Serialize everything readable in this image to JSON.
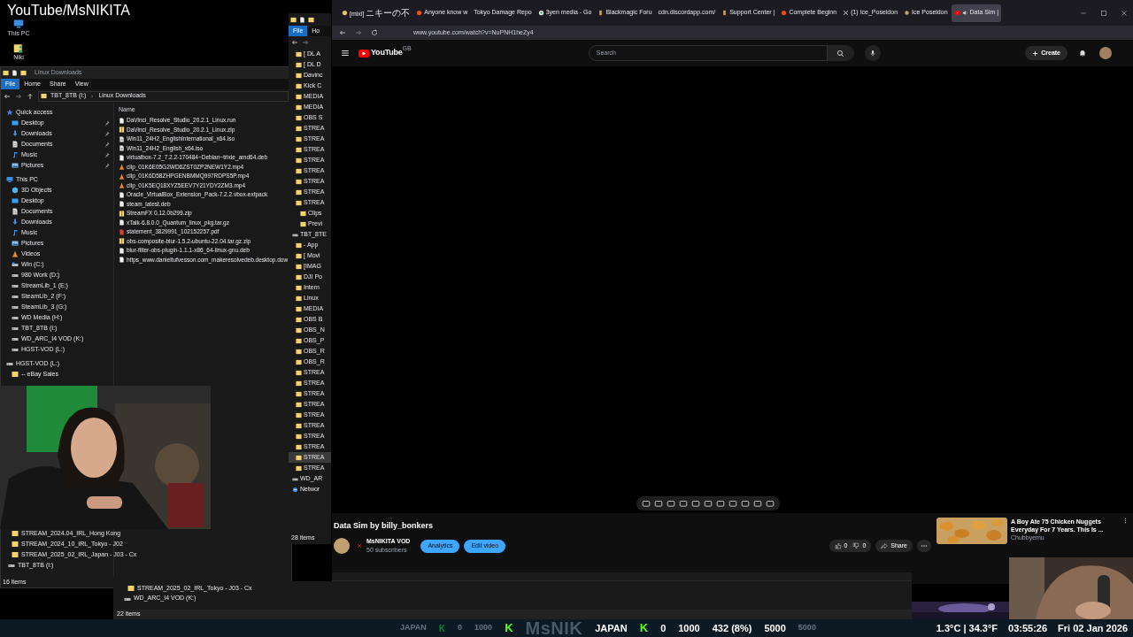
{
  "overlay_title": "YouTube/MsNIKITA",
  "desktop_icons": [
    {
      "label": "This PC",
      "kind": "pc"
    },
    {
      "label": "Niki",
      "kind": "user"
    }
  ],
  "explorer_main": {
    "title": "Linux Downloads",
    "ribbon_tabs": [
      {
        "label": "File",
        "selected": true
      },
      {
        "label": "Home",
        "selected": false
      },
      {
        "label": "Share",
        "selected": false
      },
      {
        "label": "View",
        "selected": false
      }
    ],
    "breadcrumb": [
      "TBT_8TB (I:)",
      "Linux Downloads"
    ],
    "nav_tree": [
      {
        "label": "Quick access",
        "kind": "star",
        "children": [
          {
            "label": "Desktop",
            "kind": "desktop",
            "pinned": true
          },
          {
            "label": "Downloads",
            "kind": "download",
            "pinned": true
          },
          {
            "label": "Documents",
            "kind": "doc",
            "pinned": true
          },
          {
            "label": "Music",
            "kind": "music",
            "pinned": true
          },
          {
            "label": "Pictures",
            "kind": "picture",
            "pinned": true
          }
        ]
      },
      {
        "label": "This PC",
        "kind": "pc",
        "children": [
          {
            "label": "3D Objects",
            "kind": "cube"
          },
          {
            "label": "Desktop",
            "kind": "desktop"
          },
          {
            "label": "Documents",
            "kind": "doc"
          },
          {
            "label": "Downloads",
            "kind": "download"
          },
          {
            "label": "Music",
            "kind": "music"
          },
          {
            "label": "Pictures",
            "kind": "picture"
          },
          {
            "label": "Videos",
            "kind": "video"
          },
          {
            "label": "Win (C:)",
            "kind": "windrive"
          },
          {
            "label": "980 Work (D:)",
            "kind": "drive"
          },
          {
            "label": "StreamLib_1 (E:)",
            "kind": "drive"
          },
          {
            "label": "SteamLib_2 (F:)",
            "kind": "drive"
          },
          {
            "label": "SteamLib_3 (G:)",
            "kind": "drive"
          },
          {
            "label": "WD Media (H:)",
            "kind": "drive"
          },
          {
            "label": "TBT_8TB (I:)",
            "kind": "drive"
          },
          {
            "label": "WD_ARC_I4 VOD (K:)",
            "kind": "drive"
          },
          {
            "label": "HGST-VOD (L:)",
            "kind": "drive"
          }
        ]
      },
      {
        "label": "HGST-VOD (L:)",
        "kind": "drive",
        "children": [
          {
            "label": "-- eBay Sales",
            "kind": "folder"
          }
        ]
      }
    ],
    "nav_tree_lower": [
      {
        "label": "STREAM_2024.04_IRL_Hong Kong",
        "kind": "folder"
      },
      {
        "label": "STREAM_2024_10_IRL_Tokyo - J02",
        "kind": "folder"
      },
      {
        "label": "STREAM_2025_02_IRL_Japan - J03 - Cx",
        "kind": "folder"
      },
      {
        "label": "TBT_8TB (I:)",
        "kind": "drive"
      }
    ],
    "column": "Name",
    "files": [
      {
        "name": "DaVinci_Resolve_Studio_20.2.1_Linux.run",
        "kind": "file"
      },
      {
        "name": "DaVinci_Resolve_Studio_20.2.1_Linux.zip",
        "kind": "zip"
      },
      {
        "name": "Win11_24H2_EnglishInternational_x64.iso",
        "kind": "disc"
      },
      {
        "name": "Win11_24H2_English_x64.iso",
        "kind": "disc"
      },
      {
        "name": "virtualbox-7.2_7.2.2-170484~Debian~trixie_amd64.deb",
        "kind": "file"
      },
      {
        "name": "clip_01K6E05G2WD6ZST0ZP2NEW1Y2.mp4",
        "kind": "video"
      },
      {
        "name": "clip_01K6D58ZHPGENBMMQ997RDPS5P.mp4",
        "kind": "video"
      },
      {
        "name": "clip_01K5EQ18XYZ5EEV7Y21YDY2ZM3.mp4",
        "kind": "video"
      },
      {
        "name": "Oracle_VirtualBox_Extension_Pack-7.2.2.vbox-extpack",
        "kind": "file"
      },
      {
        "name": "steam_latest.deb",
        "kind": "file"
      },
      {
        "name": "StreamFX 0.12.0b299.zip",
        "kind": "zip"
      },
      {
        "name": "xTalk-6.8.0.0_Quantum_linux_pkg.tar.gz",
        "kind": "file"
      },
      {
        "name": "statement_3829991_102152257.pdf",
        "kind": "pdf"
      },
      {
        "name": "obs-composite-blur-1.5.2-ubuntu-22.04.tar.gz.zip",
        "kind": "zip"
      },
      {
        "name": "blur-filter-obs-plugin-1.1.1-x86_64-linux-gnu.deb",
        "kind": "file"
      },
      {
        "name": "https_www.danieltufvesson.com_makeresolvedeb.desktop.dow",
        "kind": "file"
      }
    ],
    "status": "16 items"
  },
  "explorer_middle": {
    "ribbon_tabs": [
      {
        "label": "File",
        "selected": true
      },
      {
        "label": "Ho",
        "selected": false
      }
    ],
    "tree": [
      {
        "label": "[ DL A",
        "kind": "folder",
        "selected": false
      },
      {
        "label": "[ DL D",
        "kind": "folder",
        "selected": false
      },
      {
        "label": "Davinc",
        "kind": "folder",
        "selected": false
      },
      {
        "label": "Kick C",
        "kind": "folder",
        "selected": false
      },
      {
        "label": "MEDIA",
        "kind": "folder",
        "selected": false
      },
      {
        "label": "MEDIA",
        "kind": "folder",
        "selected": false
      },
      {
        "label": "OBS S",
        "kind": "folder",
        "selected": false
      },
      {
        "label": "STREA",
        "kind": "folder",
        "selected": false
      },
      {
        "label": "STREA",
        "kind": "folder",
        "selected": false
      },
      {
        "label": "STREA",
        "kind": "folder",
        "selected": false
      },
      {
        "label": "STREA",
        "kind": "folder",
        "selected": false
      },
      {
        "label": "STREA",
        "kind": "folder",
        "selected": false
      },
      {
        "label": "STREA",
        "kind": "folder",
        "selected": false
      },
      {
        "label": "STREA",
        "kind": "folder",
        "selected": false
      },
      {
        "label": "STREA",
        "kind": "folder",
        "selected": false,
        "children": [
          {
            "label": "Clips",
            "kind": "folder",
            "selected": false
          },
          {
            "label": "Previ",
            "kind": "folder",
            "selected": false
          }
        ]
      },
      {
        "label": "TBT_8TE",
        "kind": "drive",
        "selected": false,
        "children": [
          {
            "label": "- App",
            "kind": "folder",
            "selected": false
          },
          {
            "label": "[ Movi",
            "kind": "folder",
            "selected": false
          },
          {
            "label": "[IMAG",
            "kind": "folder",
            "selected": false
          },
          {
            "label": "DJI Po",
            "kind": "folder",
            "selected": false
          },
          {
            "label": "Intern",
            "kind": "folder",
            "selected": false
          },
          {
            "label": "Linux",
            "kind": "folder",
            "selected": false
          },
          {
            "label": "MEDIA",
            "kind": "folder",
            "selected": false
          },
          {
            "label": "OBS B",
            "kind": "folder",
            "selected": false
          },
          {
            "label": "OBS_N",
            "kind": "folder",
            "selected": false
          },
          {
            "label": "OBS_P",
            "kind": "folder",
            "selected": false
          },
          {
            "label": "OBS_R",
            "kind": "folder",
            "selected": false
          },
          {
            "label": "OBS_R",
            "kind": "folder",
            "selected": false
          },
          {
            "label": "STREA",
            "kind": "folder",
            "selected": false
          },
          {
            "label": "STREA",
            "kind": "folder",
            "selected": false
          },
          {
            "label": "STREA",
            "kind": "folder",
            "selected": false
          },
          {
            "label": "STREA",
            "kind": "folder",
            "selected": false
          },
          {
            "label": "STREA",
            "kind": "folder",
            "selected": false
          },
          {
            "label": "STREA",
            "kind": "folder",
            "selected": false
          },
          {
            "label": "STREA",
            "kind": "folder",
            "selected": false
          },
          {
            "label": "STREA",
            "kind": "folder",
            "selected": false
          },
          {
            "label": "STREA",
            "kind": "folder",
            "selected": true
          },
          {
            "label": "STREA",
            "kind": "folder",
            "selected": false
          }
        ]
      },
      {
        "label": "WD_AR",
        "kind": "drive",
        "selected": false
      },
      {
        "label": "Networ",
        "kind": "network",
        "selected": false
      }
    ],
    "status": "28 items"
  },
  "explorer_bottom": {
    "rows": [
      {
        "label": "STREAM_2025_02_IRL_Tokyo - J03 - Cx",
        "kind": "folder"
      },
      {
        "label": "WD_ARC_I4 VOD (K:)",
        "kind": "drive"
      }
    ],
    "status": "22 items"
  },
  "browser": {
    "tabs": [
      {
        "label": "[mixi] ニキーの不",
        "selected": false,
        "playing": false
      },
      {
        "label": "Anyone know w",
        "selected": false,
        "playing": false
      },
      {
        "label": "Tokyo Damage Repo",
        "selected": false,
        "playing": false
      },
      {
        "label": "3yen media - Go",
        "selected": false,
        "playing": false
      },
      {
        "label": "Blackmagic Foru",
        "selected": false,
        "playing": false
      },
      {
        "label": "cdn.discordapp.com/",
        "selected": false,
        "playing": false
      },
      {
        "label": "Support Center |",
        "selected": false,
        "playing": false
      },
      {
        "label": "Complete Beginn",
        "selected": false,
        "playing": false
      },
      {
        "label": "(1) Ice_Poseidon",
        "selected": false,
        "playing": false
      },
      {
        "label": "Ice Poseidon",
        "selected": false,
        "playing": false
      },
      {
        "label": "Data Sim |",
        "selected": true,
        "playing": true
      }
    ],
    "url": "www.youtube.com/watch?v=NuPNH1heZy4"
  },
  "youtube": {
    "logo": "YouTube",
    "region": "GB",
    "search_placeholder": "Search",
    "create": "Create",
    "video_title": "Data Sim by billy_bonkers",
    "channel": "MsNIKITA VOD",
    "subscribers": "50 subscribers",
    "buttons": [
      "Analytics",
      "Edit video"
    ],
    "likes": "0",
    "dislikes": "0",
    "share": "Share",
    "recommendation": {
      "title": "A Boy Ate 75 Chicken Nuggets Everyday For 7 Years. This Is ...",
      "channel": "Chubbyemu"
    }
  },
  "ticker_left": [
    {
      "text": "JAPAN",
      "kind": "dim"
    },
    {
      "text": "K",
      "kind": "kick-dim"
    },
    {
      "text": "0",
      "kind": "dim"
    },
    {
      "text": "1000",
      "kind": "dim"
    },
    {
      "text": "K",
      "kind": "kick"
    },
    {
      "text": "MsNIK",
      "kind": "ghost"
    },
    {
      "text": "JAPAN",
      "kind": "bright"
    },
    {
      "text": "K",
      "kind": "kick"
    },
    {
      "text": "0",
      "kind": "bright"
    },
    {
      "text": "1000",
      "kind": "bright"
    },
    {
      "text": "432 (8%)",
      "kind": "bright"
    },
    {
      "text": "5000",
      "kind": "bright"
    },
    {
      "text": "5000",
      "kind": "dim"
    }
  ],
  "ticker_right": [
    {
      "text": "1.3°C | 34.3°F",
      "kind": "bright"
    },
    {
      "text": "03:55:26",
      "kind": "bright"
    },
    {
      "text": "Fri 02 Jan 2026",
      "kind": "bright"
    }
  ]
}
